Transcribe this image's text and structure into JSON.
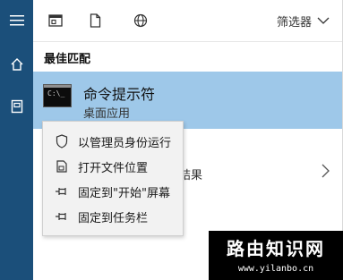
{
  "rail": {
    "icons": [
      "hamburger-icon",
      "home-icon",
      "document-icon"
    ],
    "color": "#1b4f7a"
  },
  "toolbar": {
    "filter_label": "筛选器"
  },
  "best_match": {
    "section_title": "最佳匹配",
    "app_name": "命令提示符",
    "app_type": "桌面应用",
    "highlight_color": "#9ec8e9"
  },
  "background_row": {
    "partial_text": "结果"
  },
  "context_menu": {
    "items": [
      {
        "label": "以管理员身份运行",
        "icon": "shield-icon"
      },
      {
        "label": "打开文件位置",
        "icon": "file-location-icon"
      },
      {
        "label": "固定到\"开始\"屏幕",
        "icon": "pin-icon"
      },
      {
        "label": "固定到任务栏",
        "icon": "pin-icon"
      }
    ]
  },
  "watermark": {
    "site_name": "路由知识网",
    "url": "www.yilanbo.cn"
  }
}
